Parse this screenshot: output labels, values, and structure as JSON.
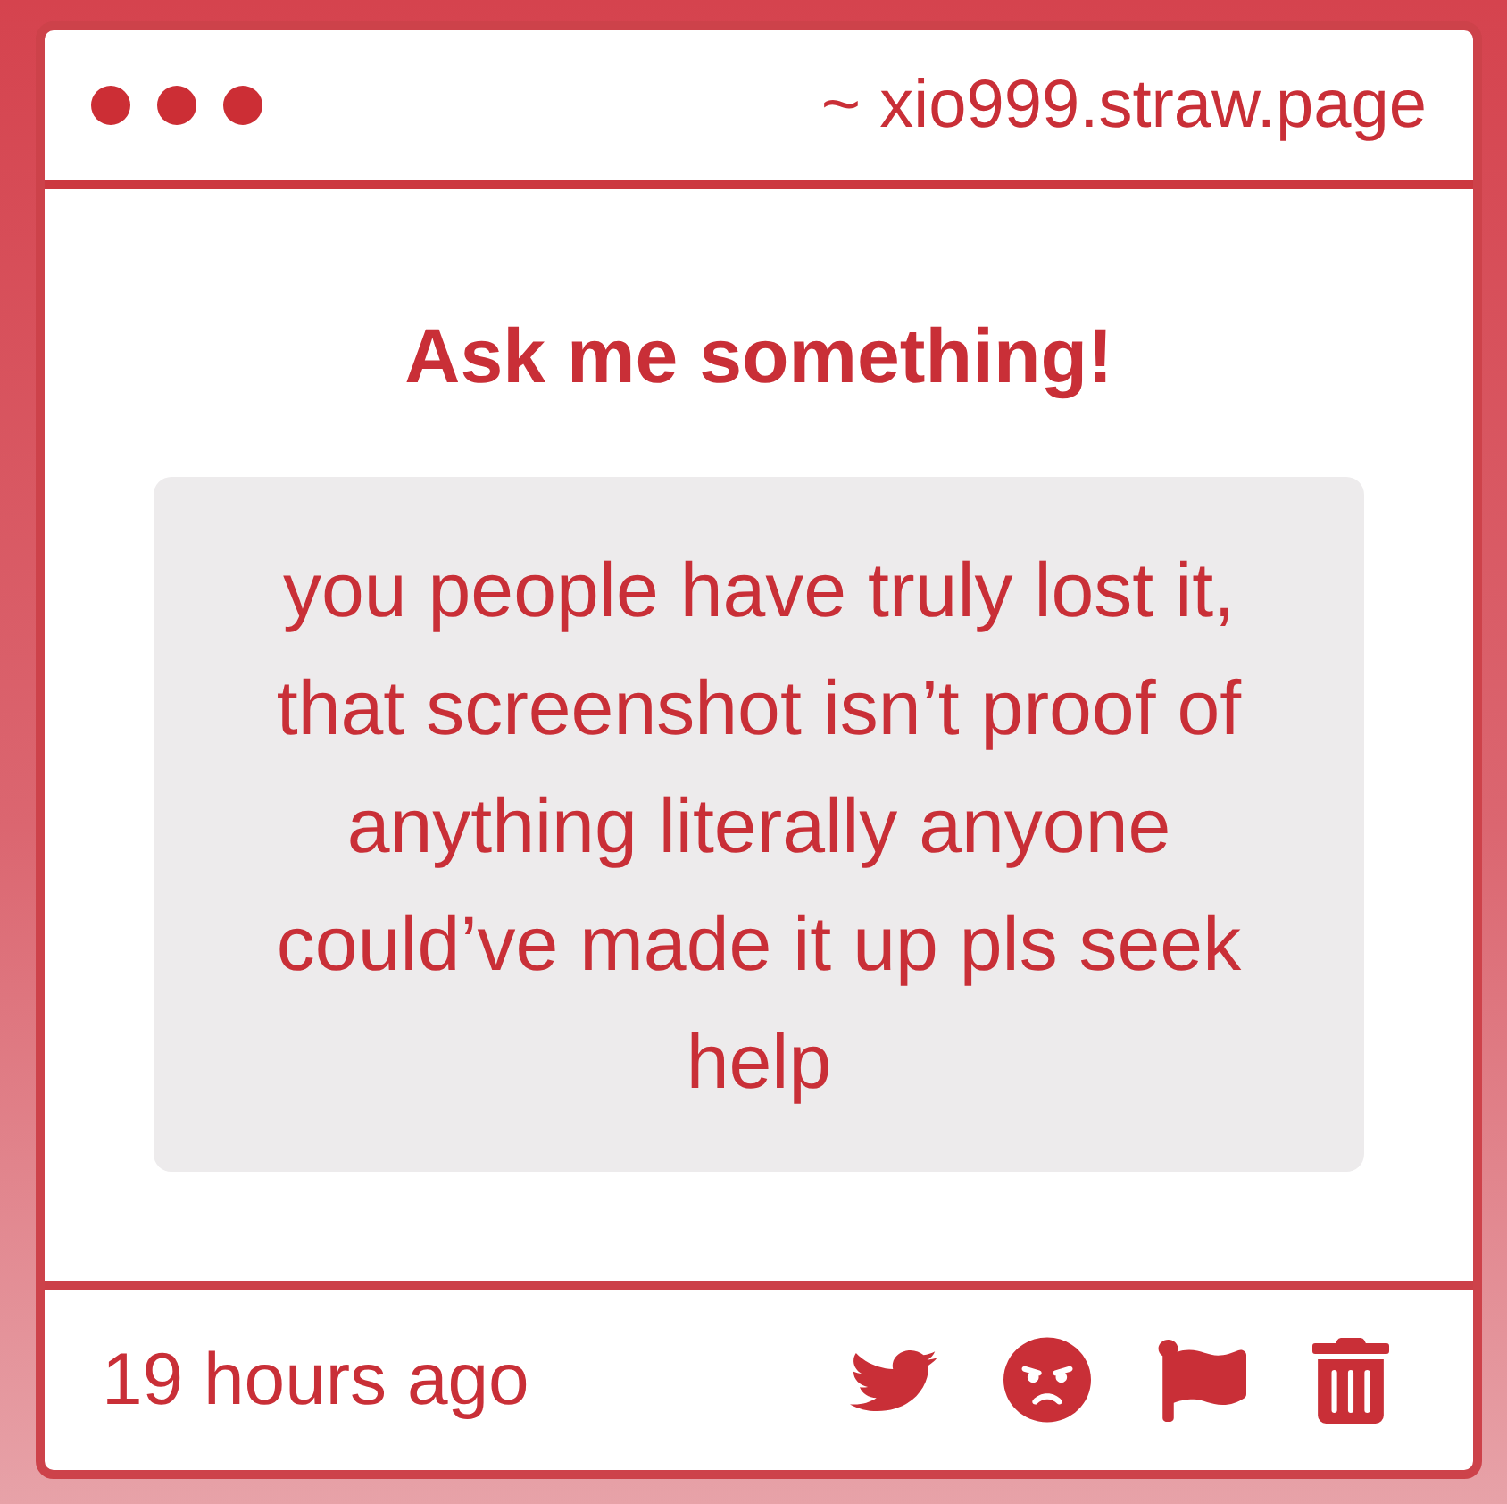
{
  "header": {
    "address": "~ xio999.straw.page"
  },
  "prompt": {
    "title": "Ask me something!"
  },
  "question": {
    "text": "you people have truly lost it, that screenshot isn’t proof of anything literally anyone could’ve made it up pls seek help"
  },
  "footer": {
    "time": "19 hours ago",
    "actions": [
      {
        "kind": "share"
      },
      {
        "kind": "react"
      },
      {
        "kind": "report"
      },
      {
        "kind": "delete"
      }
    ]
  }
}
